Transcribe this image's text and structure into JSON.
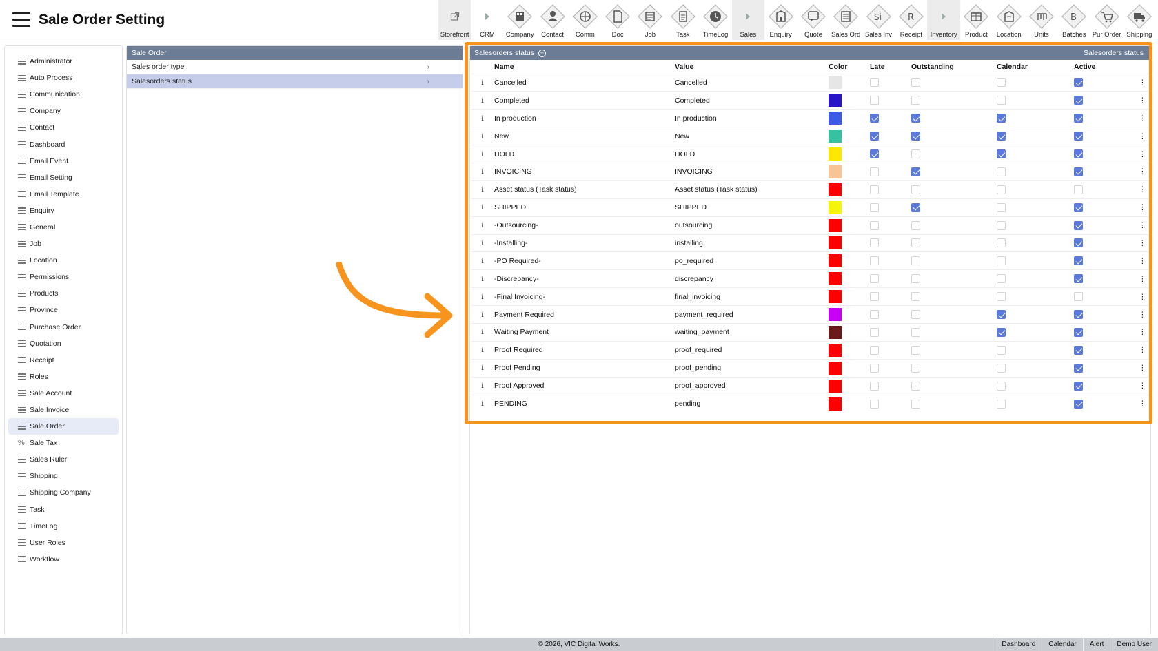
{
  "header": {
    "title": "Sale Order Setting"
  },
  "toolbar": [
    {
      "label": "Storefront",
      "icon": "external-link-icon"
    },
    {
      "label": "CRM",
      "icon": "caret-right-icon"
    },
    {
      "label": "Company",
      "icon": "company-icon"
    },
    {
      "label": "Contact",
      "icon": "contact-icon"
    },
    {
      "label": "Comm",
      "icon": "comm-icon"
    },
    {
      "label": "Doc",
      "icon": "doc-icon"
    },
    {
      "label": "Job",
      "icon": "job-icon"
    },
    {
      "label": "Task",
      "icon": "task-icon"
    },
    {
      "label": "TimeLog",
      "icon": "clock-icon"
    },
    {
      "label": "Sales",
      "icon": "caret-right-icon"
    },
    {
      "label": "Enquiry",
      "icon": "enquiry-icon"
    },
    {
      "label": "Quote",
      "icon": "quote-icon"
    },
    {
      "label": "Sales Ord",
      "icon": "sales-order-icon"
    },
    {
      "label": "Sales Inv",
      "icon": "sales-invoice-icon"
    },
    {
      "label": "Receipt",
      "icon": "receipt-icon"
    },
    {
      "label": "Inventory",
      "icon": "caret-right-icon"
    },
    {
      "label": "Product",
      "icon": "product-icon"
    },
    {
      "label": "Location",
      "icon": "location-icon"
    },
    {
      "label": "Units",
      "icon": "units-icon"
    },
    {
      "label": "Batches",
      "icon": "batches-icon"
    },
    {
      "label": "Pur Order",
      "icon": "cart-icon"
    },
    {
      "label": "Shipping",
      "icon": "truck-icon"
    }
  ],
  "sidebar": {
    "items": [
      "Administrator",
      "Auto Process",
      "Communication",
      "Company",
      "Contact",
      "Dashboard",
      "Email Event",
      "Email Setting",
      "Email Template",
      "Enquiry",
      "General",
      "Job",
      "Location",
      "Permissions",
      "Products",
      "Province",
      "Purchase Order",
      "Quotation",
      "Receipt",
      "Roles",
      "Sale Account",
      "Sale Invoice",
      "Sale Order",
      "Sale Tax",
      "Sales Ruler",
      "Shipping",
      "Shipping Company",
      "Task",
      "TimeLog",
      "User Roles",
      "Workflow"
    ],
    "active": "Sale Order"
  },
  "middle": {
    "header": "Sale Order",
    "rows": [
      "Sales order type",
      "Salesorders status"
    ],
    "selected": "Salesorders status"
  },
  "right": {
    "title": "Salesorders status",
    "right_label": "Salesorders status",
    "columns": {
      "name": "Name",
      "value": "Value",
      "color": "Color",
      "late": "Late",
      "outstanding": "Outstanding",
      "calendar": "Calendar",
      "active": "Active"
    },
    "info_glyph": "i",
    "kebab_glyph": "⋮",
    "rows": [
      {
        "name": "Cancelled",
        "value": "Cancelled",
        "color": "#e6e6e6",
        "late": false,
        "outstanding": false,
        "calendar": false,
        "active": true
      },
      {
        "name": "Completed",
        "value": "Completed",
        "color": "#2a14c8",
        "late": false,
        "outstanding": false,
        "calendar": false,
        "active": true
      },
      {
        "name": "In production",
        "value": "In production",
        "color": "#3d5ae6",
        "late": true,
        "outstanding": true,
        "calendar": true,
        "active": true
      },
      {
        "name": "New",
        "value": "New",
        "color": "#36c2a0",
        "late": true,
        "outstanding": true,
        "calendar": true,
        "active": true
      },
      {
        "name": "HOLD",
        "value": "HOLD",
        "color": "#ffe800",
        "late": true,
        "outstanding": false,
        "calendar": true,
        "active": true
      },
      {
        "name": "INVOICING",
        "value": "INVOICING",
        "color": "#f7c595",
        "late": false,
        "outstanding": true,
        "calendar": false,
        "active": true
      },
      {
        "name": "Asset status (Task status)",
        "value": "Asset status (Task status)",
        "color": "#ff0000",
        "late": false,
        "outstanding": false,
        "calendar": false,
        "active": false
      },
      {
        "name": "SHIPPED",
        "value": "SHIPPED",
        "color": "#f5f50a",
        "late": false,
        "outstanding": true,
        "calendar": false,
        "active": true
      },
      {
        "name": "-Outsourcing-",
        "value": "outsourcing",
        "color": "#ff0000",
        "late": false,
        "outstanding": false,
        "calendar": false,
        "active": true
      },
      {
        "name": "-Installing-",
        "value": "installing",
        "color": "#ff0000",
        "late": false,
        "outstanding": false,
        "calendar": false,
        "active": true
      },
      {
        "name": "-PO Required-",
        "value": "po_required",
        "color": "#ff0000",
        "late": false,
        "outstanding": false,
        "calendar": false,
        "active": true
      },
      {
        "name": "-Discrepancy-",
        "value": "discrepancy",
        "color": "#ff0000",
        "late": false,
        "outstanding": false,
        "calendar": false,
        "active": true
      },
      {
        "name": "-Final Invoicing-",
        "value": "final_invoicing",
        "color": "#ff0000",
        "late": false,
        "outstanding": false,
        "calendar": false,
        "active": false
      },
      {
        "name": "Payment Required",
        "value": "payment_required",
        "color": "#c800f5",
        "late": false,
        "outstanding": false,
        "calendar": true,
        "active": true
      },
      {
        "name": "Waiting Payment",
        "value": "waiting_payment",
        "color": "#6b1a1a",
        "late": false,
        "outstanding": false,
        "calendar": true,
        "active": true
      },
      {
        "name": "Proof Required",
        "value": "proof_required",
        "color": "#ff0000",
        "late": false,
        "outstanding": false,
        "calendar": false,
        "active": true
      },
      {
        "name": "Proof Pending",
        "value": "proof_pending",
        "color": "#ff0000",
        "late": false,
        "outstanding": false,
        "calendar": false,
        "active": true
      },
      {
        "name": "Proof Approved",
        "value": "proof_approved",
        "color": "#ff0000",
        "late": false,
        "outstanding": false,
        "calendar": false,
        "active": true
      },
      {
        "name": "PENDING",
        "value": "pending",
        "color": "#ff0000",
        "late": false,
        "outstanding": false,
        "calendar": false,
        "active": true
      }
    ]
  },
  "annotation": {
    "highlight_color": "#f7941d"
  },
  "footer": {
    "copyright": "© 2026, VIC Digital Works.",
    "links": [
      "Dashboard",
      "Calendar",
      "Alert",
      "Demo User"
    ]
  }
}
